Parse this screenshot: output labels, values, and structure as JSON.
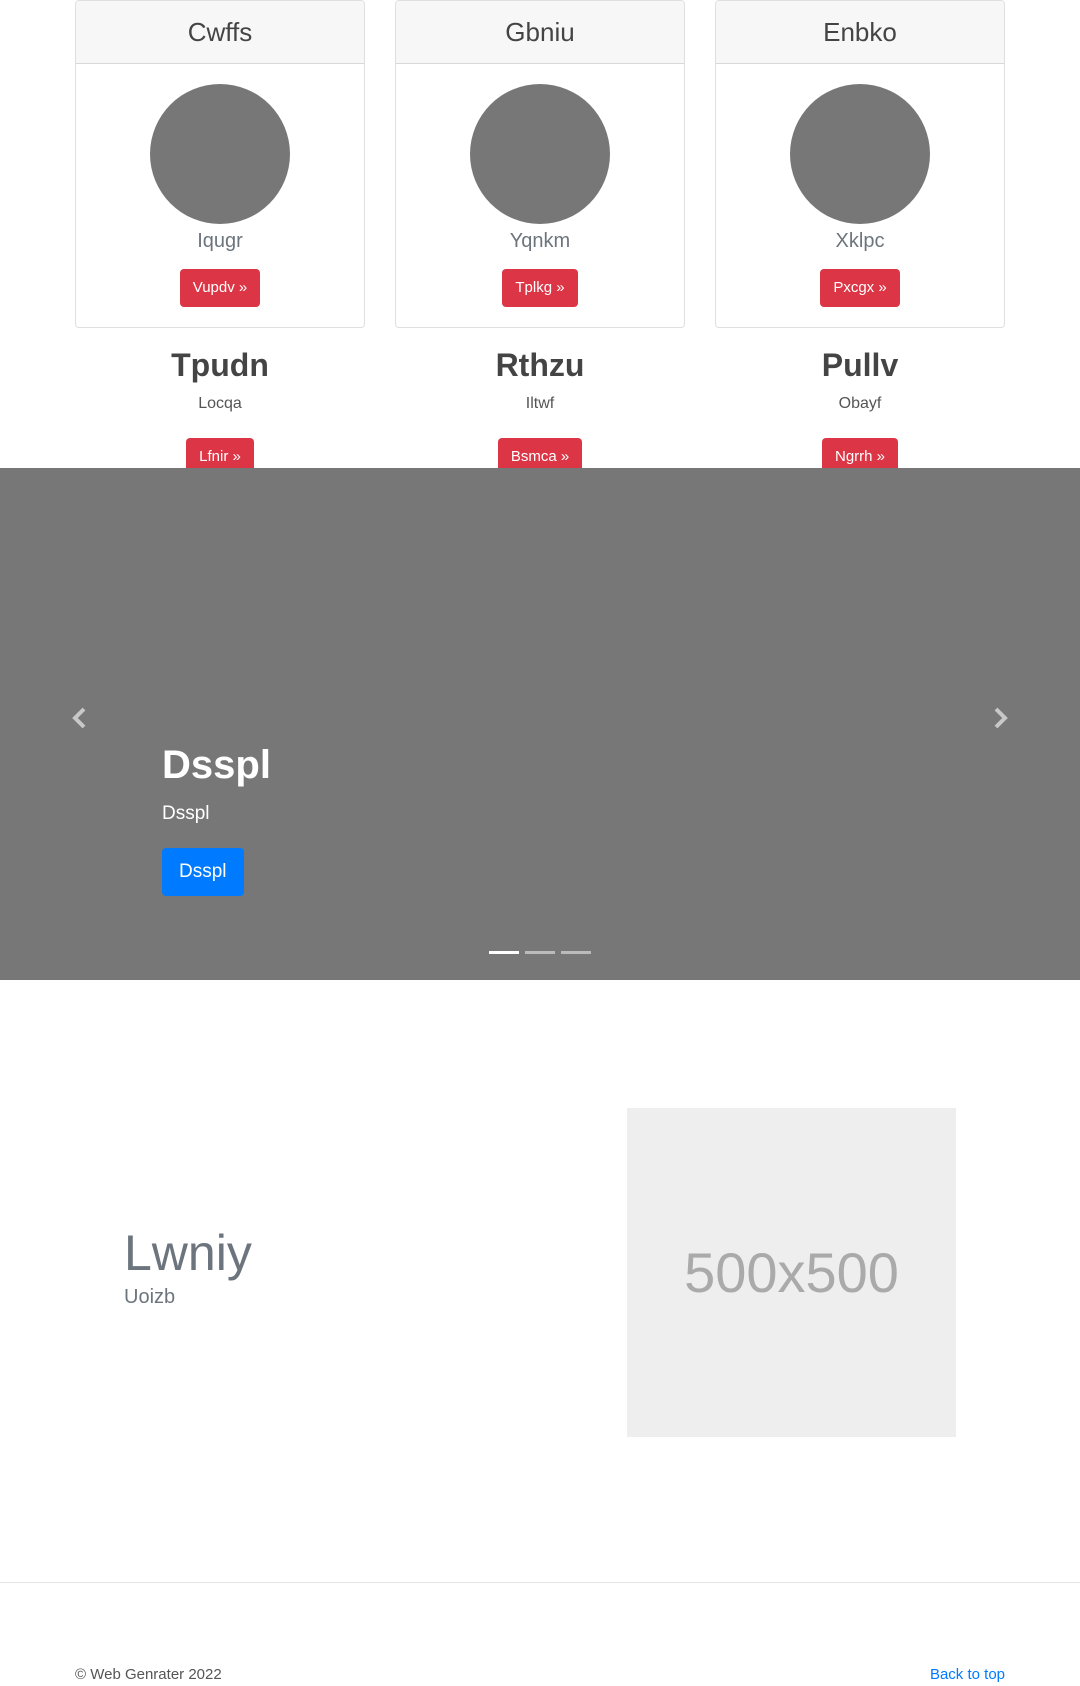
{
  "cards": [
    {
      "title": "Cwffs",
      "subtitle": "Iqugr",
      "button": "Vupdv »"
    },
    {
      "title": "Gbniu",
      "subtitle": "Yqnkm",
      "button": "Tplkg »"
    },
    {
      "title": "Enbko",
      "subtitle": "Xklpc",
      "button": "Pxcgx »"
    }
  ],
  "features": [
    {
      "title": "Tpudn",
      "text": "Locqa",
      "button": "Lfnir »"
    },
    {
      "title": "Rthzu",
      "text": "Iltwf",
      "button": "Bsmca »"
    },
    {
      "title": "Pullv",
      "text": "Obayf",
      "button": "Ngrrh »"
    }
  ],
  "carousel": {
    "caption_title": "Dsspl",
    "caption_text": "Dsspl",
    "caption_button": "Dsspl",
    "slide_count": 3,
    "active_index": 0
  },
  "featurette": {
    "heading": "Lwniy",
    "lead": "Uoizb",
    "image_label": "500x500"
  },
  "footer": {
    "copyright": "© Web Genrater 2022",
    "back_to_top": "Back to top"
  }
}
